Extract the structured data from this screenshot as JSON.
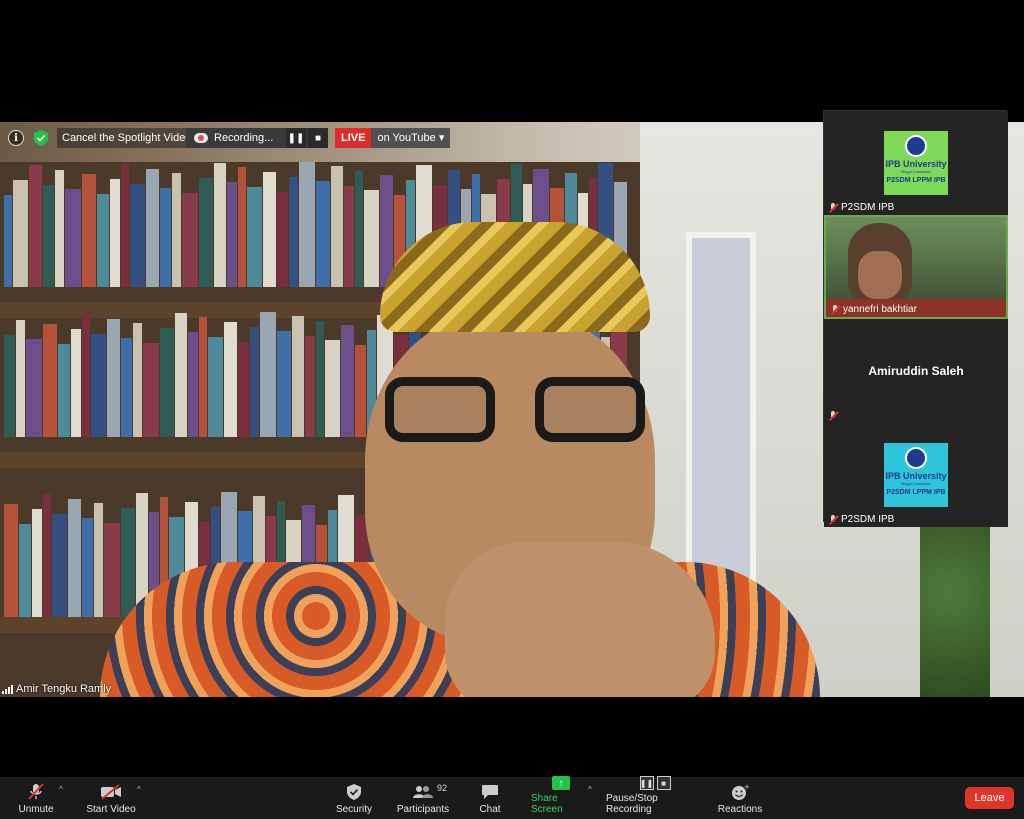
{
  "top_bar": {
    "spotlight_label": "Cancel the Spotlight Video",
    "recording_label": "Recording...",
    "pause_symbol": "❚❚",
    "stop_symbol": "■",
    "live_label": "LIVE",
    "youtube_label": "on YouTube ▾"
  },
  "main_video": {
    "speaker_name": "Amir Tengku Ramly"
  },
  "gallery": {
    "tiles": [
      {
        "name": "P2SDM IPB",
        "type": "logo",
        "bg": "#7ed957",
        "logo_title": "IPB University",
        "logo_sub": "Bogor Indonesia",
        "logo_caption": "P2SDM LPPM IPB"
      },
      {
        "name": "yannefri bakhtiar",
        "type": "camera"
      },
      {
        "name": "Amiruddin Saleh",
        "type": "name-only"
      },
      {
        "name": "P2SDM IPB",
        "type": "logo",
        "bg": "#2ec4d9",
        "logo_title": "IPB University",
        "logo_sub": "Bogor Indonesia",
        "logo_caption": "P2SDM LPPM IPB"
      }
    ]
  },
  "toolbar": {
    "unmute": "Unmute",
    "start_video": "Start Video",
    "security": "Security",
    "participants": "Participants",
    "participants_count": "92",
    "chat": "Chat",
    "share_screen": "Share Screen",
    "recording": "Pause/Stop Recording",
    "reactions": "Reactions",
    "leave": "Leave"
  },
  "colors": {
    "live_red": "#e02b2b",
    "share_green": "#24c24a",
    "leave_red": "#e0352b"
  },
  "icons": [
    "info-icon",
    "shield-icon",
    "recording-cloud-icon",
    "pause-icon",
    "stop-icon",
    "signal-icon",
    "mic-muted-icon",
    "video-off-icon",
    "security-shield-icon",
    "participants-icon",
    "chat-icon",
    "share-screen-icon",
    "reactions-icon",
    "chevron-up-icon"
  ]
}
